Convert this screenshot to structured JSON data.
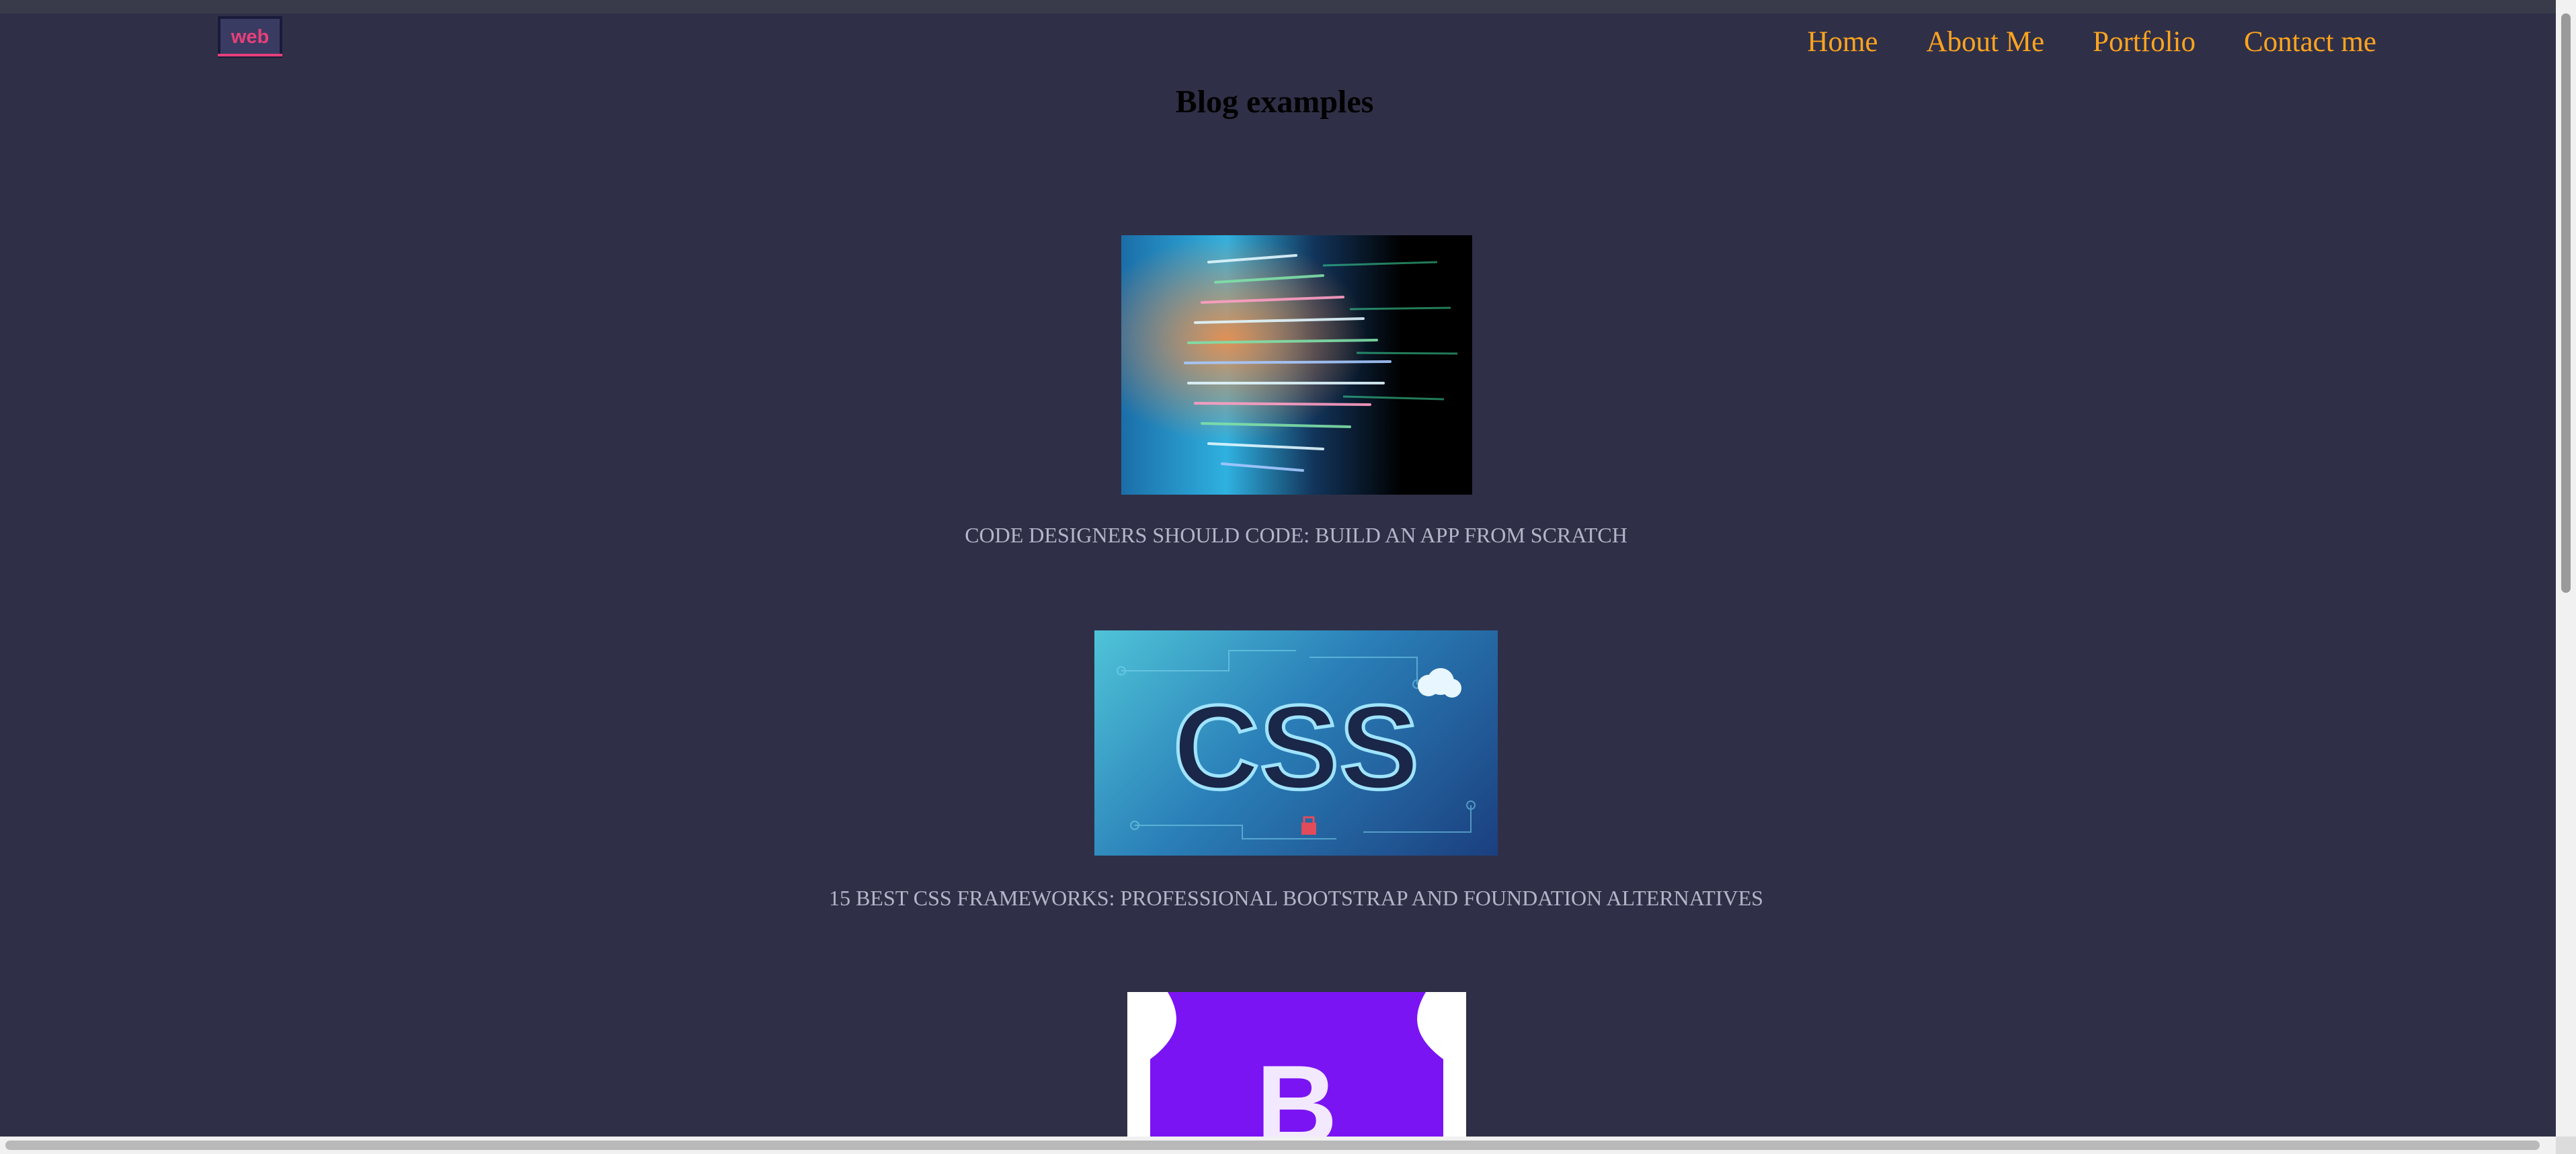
{
  "logo": {
    "text": "web"
  },
  "nav": {
    "items": [
      "Home",
      "About Me",
      "Portfolio",
      "Contact me"
    ]
  },
  "page": {
    "title": "Blog examples"
  },
  "posts": [
    {
      "caption": "CODE DESIGNERS SHOULD CODE: BUILD AN APP FROM SCRATCH",
      "image_text": ""
    },
    {
      "caption": "15 BEST CSS FRAMEWORKS: PROFESSIONAL BOOTSTRAP AND FOUNDATION ALTERNATIVES",
      "image_text": "CSS"
    },
    {
      "caption": "",
      "image_text": "B"
    }
  ],
  "colors": {
    "background": "#2f3047",
    "nav_link": "#ffa41f",
    "logo_text": "#e6407a",
    "caption": "#b5b4c9",
    "title": "#000000"
  },
  "icons": [
    "cloud-icon",
    "lock-icon"
  ]
}
